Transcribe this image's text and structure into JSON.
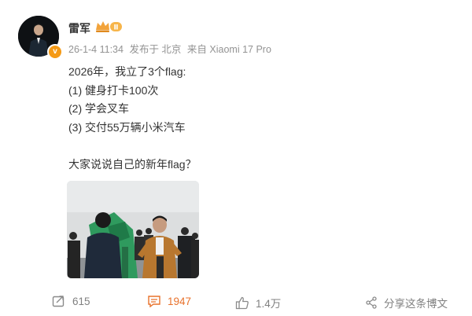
{
  "post": {
    "author": {
      "name": "雷军"
    },
    "meta": {
      "timestamp": "26-1-4 11:34",
      "location": "发布于 北京",
      "source": "来自 Xiaomi 17 Pro"
    },
    "content_lines": [
      "2026年，我立了3个flag:",
      "(1) 健身打卡100次",
      "(2) 学会叉车",
      "(3) 交付55万辆小米汽车",
      "",
      "大家说说自己的新年flag？"
    ],
    "actions": {
      "repost_count": "615",
      "comment_count": "1947",
      "like_count": "1.4万",
      "share_label": "分享这条博文"
    },
    "colors": {
      "accent_comment": "#e8722c",
      "badge_orange": "#f59a16",
      "meta_gray": "#939393"
    }
  }
}
